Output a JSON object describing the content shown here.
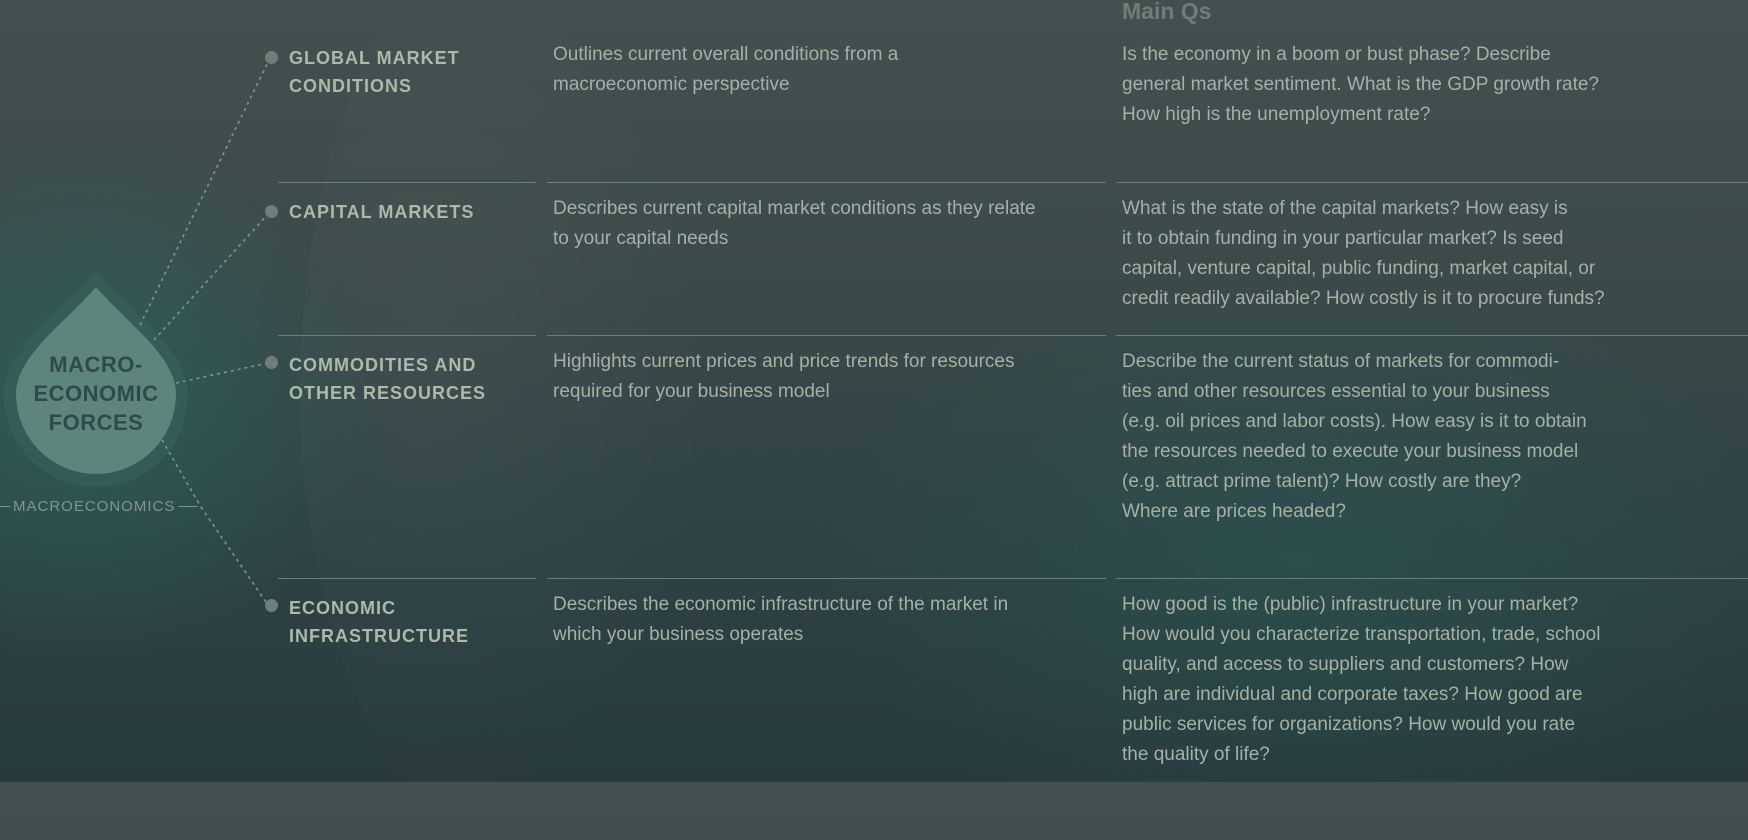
{
  "colors": {
    "background_top": "#435050",
    "background_bottom": "#283a3e",
    "accent_teal": "#2e6a62",
    "text": "#a6b0a4",
    "heading": "#aeb9a8"
  },
  "diagram": {
    "center_label_lines": [
      "MACRO-",
      "ECONOMIC",
      "FORCES"
    ],
    "side_label": "MACROECONOMICS",
    "column_header": "Main Qs"
  },
  "rows": [
    {
      "title": "GLOBAL MARKET CONDITIONS",
      "description": "Outlines current overall conditions from a macroeconomic perspective",
      "questions": [
        "Is the economy in a boom or bust phase? Describe",
        "general market sentiment. What is the GDP growth rate?",
        "How high is the unemployment rate?"
      ]
    },
    {
      "title": "CAPITAL MARKETS",
      "description": "Describes current capital market conditions as they relate to your capital needs",
      "questions": [
        "What is the state of the capital markets? How easy is",
        "it to obtain funding in your particular market? Is seed",
        "capital, venture capital, public funding, market capital, or",
        "credit readily available? How costly is it to procure funds?"
      ]
    },
    {
      "title": "COMMODITIES AND OTHER RESOURCES",
      "description": "Highlights current prices and price trends for resources required for your business model",
      "questions": [
        "Describe the current status of markets for commodi-",
        "ties and other resources essential to your business",
        "(e.g. oil prices and labor costs). How easy is it to obtain",
        "the resources needed to execute your business model",
        "(e.g. attract prime talent)? How costly are they?",
        "Where are prices headed?"
      ]
    },
    {
      "title": "ECONOMIC INFRASTRUCTURE",
      "description": "Describes the economic infrastructure of the market in which your business operates",
      "questions": [
        "How good is the (public) infrastructure in your market?",
        "How would you characterize transportation, trade, school",
        "quality, and access to suppliers and customers? How",
        "high are individual and corporate taxes? How good are",
        "public services for organizations? How would you rate",
        "the quality of life?"
      ]
    }
  ]
}
